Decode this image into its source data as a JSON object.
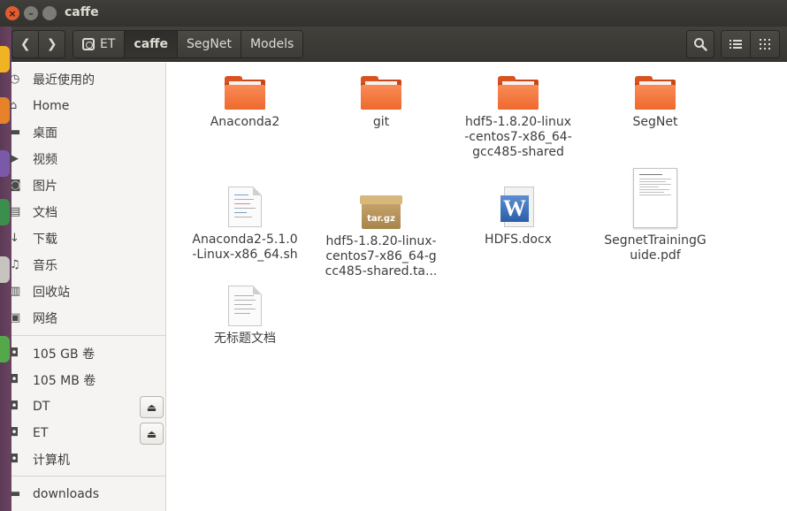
{
  "window": {
    "title": "caffe",
    "close_glyph": "×",
    "min_glyph": "–",
    "max_glyph": ""
  },
  "toolbar": {
    "back_glyph": "❮",
    "forward_glyph": "❯",
    "breadcrumbs": [
      {
        "label": "ET",
        "has_drive_icon": true
      },
      {
        "label": "caffe",
        "active": true
      },
      {
        "label": "SegNet"
      },
      {
        "label": "Models"
      }
    ],
    "search_glyph": "⚲",
    "list_view_glyph": "☰",
    "grid_view_glyph": "⠿"
  },
  "sidebar": {
    "items": [
      {
        "label": "最近使用的",
        "icon": "clock-icon",
        "glyph": "◷"
      },
      {
        "label": "Home",
        "icon": "home-icon",
        "glyph": "⌂"
      },
      {
        "label": "桌面",
        "icon": "folder-icon",
        "glyph": "▬"
      },
      {
        "label": "视频",
        "icon": "video-icon",
        "glyph": "▶"
      },
      {
        "label": "图片",
        "icon": "camera-icon",
        "glyph": "◙"
      },
      {
        "label": "文档",
        "icon": "document-icon",
        "glyph": "▤"
      },
      {
        "label": "下载",
        "icon": "download-icon",
        "glyph": "↓"
      },
      {
        "label": "音乐",
        "icon": "music-icon",
        "glyph": "♫"
      },
      {
        "label": "回收站",
        "icon": "trash-icon",
        "glyph": "▥"
      },
      {
        "label": "网络",
        "icon": "network-icon",
        "glyph": "▣"
      },
      {
        "label": "105 GB 卷",
        "icon": "drive-icon",
        "glyph": "◘"
      },
      {
        "label": "105 MB 卷",
        "icon": "drive-icon",
        "glyph": "◘"
      },
      {
        "label": "DT",
        "icon": "drive-icon",
        "glyph": "◘"
      },
      {
        "label": "ET",
        "icon": "drive-icon",
        "glyph": "◘"
      },
      {
        "label": "计算机",
        "icon": "drive-icon",
        "glyph": "◘"
      },
      {
        "label": "downloads",
        "icon": "folder-icon",
        "glyph": "▬"
      }
    ],
    "eject_glyph": "⏏"
  },
  "files": [
    {
      "name": "Anaconda2",
      "type": "folder"
    },
    {
      "name": "git",
      "type": "folder"
    },
    {
      "name": "hdf5-1.8.20-linux-centos7-x86_64-gcc485-shared",
      "type": "folder"
    },
    {
      "name": "SegNet",
      "type": "folder"
    },
    {
      "name": "Anaconda2-5.1.0-Linux-x86_64.sh",
      "type": "script"
    },
    {
      "name": "hdf5-1.8.20-linux-centos7-x86_64-gcc485-shared.ta...",
      "type": "archive",
      "badge": "tar.gz"
    },
    {
      "name": "HDFS.docx",
      "type": "word",
      "badge": "W"
    },
    {
      "name": "SegnetTrainingGuide.pdf",
      "type": "pdf"
    },
    {
      "name": "无标题文档",
      "type": "text"
    }
  ],
  "colors": {
    "accent": "#ee6a2e",
    "titlebar": "#3a3935",
    "sidebar_bg": "#f5f4f2"
  }
}
